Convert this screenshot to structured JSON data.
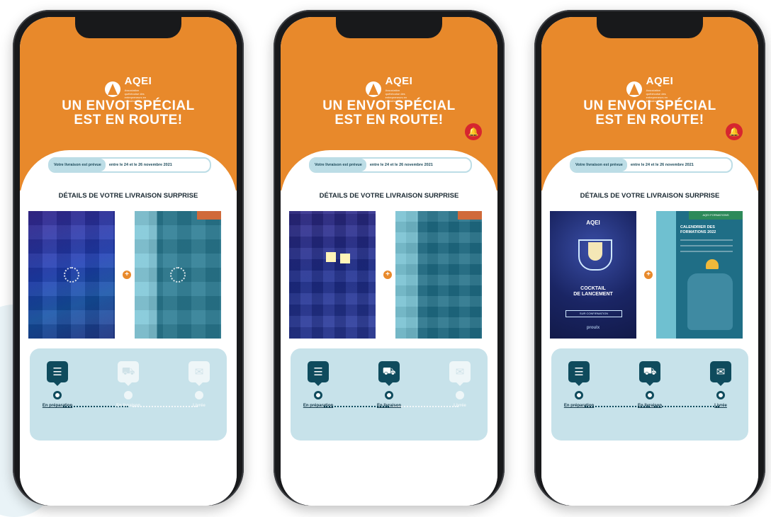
{
  "brand": {
    "name": "AQEI",
    "tagline": "Association québécoise des entrepreneurs en infrastructure"
  },
  "headline": {
    "line1": "UN ENVOI SPÉCIAL",
    "line2": "EST EN ROUTE!"
  },
  "delivery": {
    "label": "Votre livraison est prévue",
    "dates": "entre le 24 et le 26 novembre 2021"
  },
  "section_title": "DÉTAILS DE VOTRE LIVRAISON SURPRISE",
  "steps": [
    "En préparation",
    "En livraison",
    "Livrée"
  ],
  "posters": {
    "cocktail_title_1": "COCKTAIL",
    "cocktail_title_2": "DE LANCEMENT",
    "cocktail_button": "SUR CONFIRMATION",
    "cocktail_footer": "proulx",
    "calendar_top": "AQEI FORMATIONS",
    "calendar_title_1": "CALENDRIER DES",
    "calendar_title_2": "FORMATIONS 2022"
  },
  "colors": {
    "orange": "#e8892b",
    "teal_dark": "#0f4b5d",
    "tracker_bg": "#c7e2ea",
    "badge_red": "#d6262f"
  },
  "icons": {
    "checklist": "checklist-icon",
    "truck": "delivery-truck-icon",
    "envelope": "envelope-icon",
    "bell": "bell-icon",
    "plus": "plus-icon"
  }
}
